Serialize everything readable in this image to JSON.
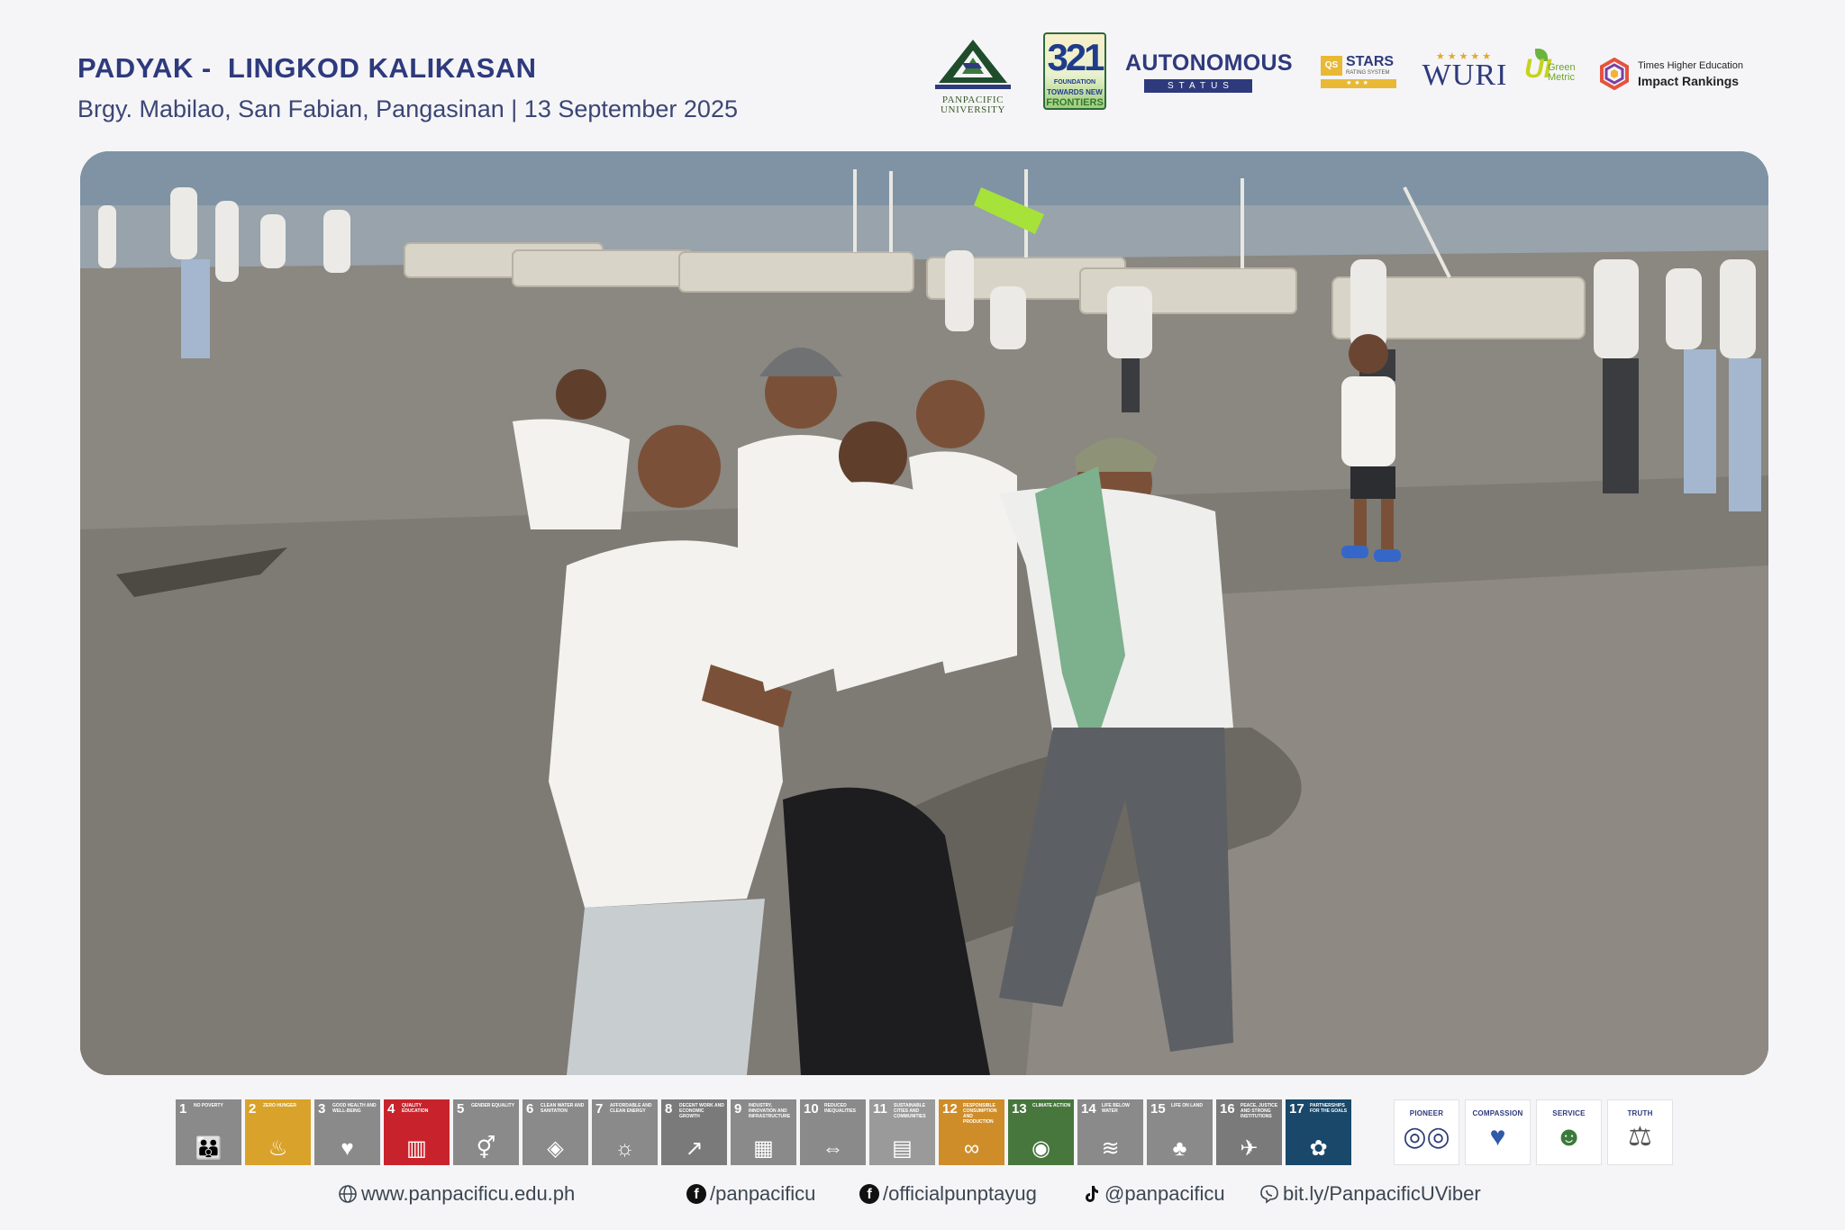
{
  "header": {
    "title": "PADYAK -  LINGKOD KALIKASAN",
    "subtitle": "Brgy. Mabilao, San Fabian, Pangasinan | 13 September 2025"
  },
  "logos": {
    "panpacific": "PANPACIFIC\nUNIVERSITY",
    "foundation_number": "321",
    "foundation_label": "FOUNDATION",
    "foundation_towards": "TOWARDS NEW",
    "foundation_frontiers": "FRONTIERS",
    "autonomous": "AUTONOMOUS",
    "autonomous_status": "STATUS",
    "qs_mark": "QS",
    "stars": "STARS",
    "stars_sub": "RATING SYSTEM",
    "stars_bar": "★★★",
    "wuri_stars": "★★★★★",
    "wuri": "WURI",
    "uigm_ui": "UI",
    "uigm_green": "Green\nMetric",
    "the_line1": "Times Higher Education",
    "the_line2": "Impact Rankings"
  },
  "sdgs": [
    {
      "num": "1",
      "label": "NO POVERTY",
      "color": "#8a8a8a",
      "icon": "family-icon"
    },
    {
      "num": "2",
      "label": "ZERO HUNGER",
      "color": "#d9a22a",
      "icon": "bowl-icon"
    },
    {
      "num": "3",
      "label": "GOOD HEALTH AND WELL-BEING",
      "color": "#8a8a8a",
      "icon": "heartbeat-icon"
    },
    {
      "num": "4",
      "label": "QUALITY EDUCATION",
      "color": "#c8232c",
      "icon": "book-icon"
    },
    {
      "num": "5",
      "label": "GENDER EQUALITY",
      "color": "#8a8a8a",
      "icon": "gender-icon"
    },
    {
      "num": "6",
      "label": "CLEAN WATER AND SANITATION",
      "color": "#8a8a8a",
      "icon": "water-icon"
    },
    {
      "num": "7",
      "label": "AFFORDABLE AND CLEAN ENERGY",
      "color": "#8a8a8a",
      "icon": "sun-icon"
    },
    {
      "num": "8",
      "label": "DECENT WORK AND ECONOMIC GROWTH",
      "color": "#7a7a7a",
      "icon": "growth-icon"
    },
    {
      "num": "9",
      "label": "INDUSTRY, INNOVATION AND INFRASTRUCTURE",
      "color": "#8a8a8a",
      "icon": "cubes-icon"
    },
    {
      "num": "10",
      "label": "REDUCED INEQUALITIES",
      "color": "#8a8a8a",
      "icon": "arrows-icon"
    },
    {
      "num": "11",
      "label": "SUSTAINABLE CITIES AND COMMUNITIES",
      "color": "#9a9a9a",
      "icon": "city-icon"
    },
    {
      "num": "12",
      "label": "RESPONSIBLE CONSUMPTION AND PRODUCTION",
      "color": "#cf8d2a",
      "icon": "infinity-icon"
    },
    {
      "num": "13",
      "label": "CLIMATE ACTION",
      "color": "#48773e",
      "icon": "eye-icon"
    },
    {
      "num": "14",
      "label": "LIFE BELOW WATER",
      "color": "#8a8a8a",
      "icon": "fish-icon"
    },
    {
      "num": "15",
      "label": "LIFE ON LAND",
      "color": "#8a8a8a",
      "icon": "tree-icon"
    },
    {
      "num": "16",
      "label": "PEACE, JUSTICE AND STRONG INSTITUTIONS",
      "color": "#7a7a7a",
      "icon": "dove-icon"
    },
    {
      "num": "17",
      "label": "PARTNERSHIPS FOR THE GOALS",
      "color": "#19486a",
      "icon": "flower-icon"
    }
  ],
  "values": [
    {
      "label": "PIONEER",
      "icon": "binoculars-icon"
    },
    {
      "label": "COMPASSION",
      "icon": "heart-hands-icon"
    },
    {
      "label": "SERVICE",
      "icon": "people-icon"
    },
    {
      "label": "TRUTH",
      "icon": "scales-icon"
    }
  ],
  "footer": {
    "website": "www.panpacificu.edu.ph",
    "facebook1": "/panpacificu",
    "facebook2": "/officialpunptayug",
    "tiktok": "@panpacificu",
    "viber": "bit.ly/PanpacificUViber"
  }
}
